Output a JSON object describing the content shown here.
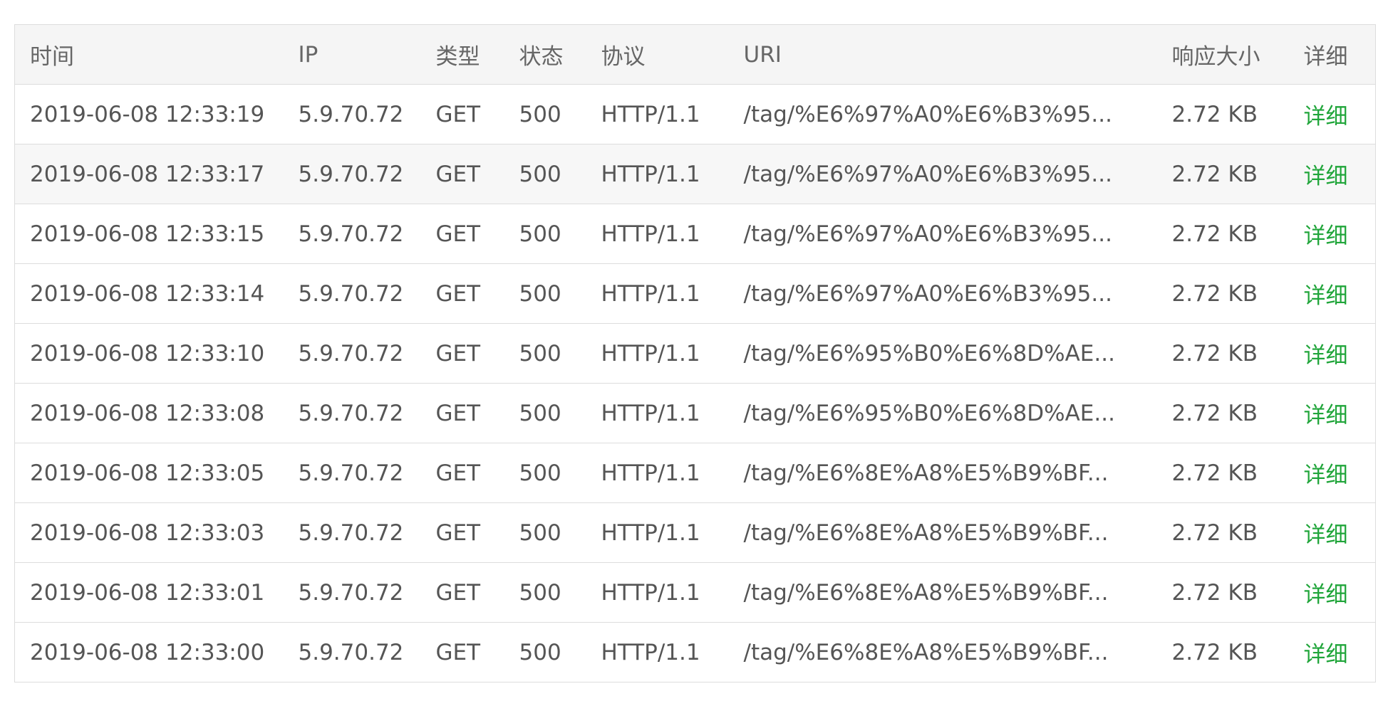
{
  "columns": {
    "time": "时间",
    "ip": "IP",
    "type": "类型",
    "status": "状态",
    "protocol": "协议",
    "uri": "URI",
    "size": "响应大小",
    "detail": "详细"
  },
  "rows": [
    {
      "time": "2019-06-08 12:33:19",
      "ip": "5.9.70.72",
      "type": "GET",
      "status": "500",
      "protocol": "HTTP/1.1",
      "uri": "/tag/%E6%97%A0%E6%B3%95...",
      "size": "2.72 KB",
      "detail": "详细"
    },
    {
      "time": "2019-06-08 12:33:17",
      "ip": "5.9.70.72",
      "type": "GET",
      "status": "500",
      "protocol": "HTTP/1.1",
      "uri": "/tag/%E6%97%A0%E6%B3%95...",
      "size": "2.72 KB",
      "detail": "详细"
    },
    {
      "time": "2019-06-08 12:33:15",
      "ip": "5.9.70.72",
      "type": "GET",
      "status": "500",
      "protocol": "HTTP/1.1",
      "uri": "/tag/%E6%97%A0%E6%B3%95...",
      "size": "2.72 KB",
      "detail": "详细"
    },
    {
      "time": "2019-06-08 12:33:14",
      "ip": "5.9.70.72",
      "type": "GET",
      "status": "500",
      "protocol": "HTTP/1.1",
      "uri": "/tag/%E6%97%A0%E6%B3%95...",
      "size": "2.72 KB",
      "detail": "详细"
    },
    {
      "time": "2019-06-08 12:33:10",
      "ip": "5.9.70.72",
      "type": "GET",
      "status": "500",
      "protocol": "HTTP/1.1",
      "uri": "/tag/%E6%95%B0%E6%8D%AE...",
      "size": "2.72 KB",
      "detail": "详细"
    },
    {
      "time": "2019-06-08 12:33:08",
      "ip": "5.9.70.72",
      "type": "GET",
      "status": "500",
      "protocol": "HTTP/1.1",
      "uri": "/tag/%E6%95%B0%E6%8D%AE...",
      "size": "2.72 KB",
      "detail": "详细"
    },
    {
      "time": "2019-06-08 12:33:05",
      "ip": "5.9.70.72",
      "type": "GET",
      "status": "500",
      "protocol": "HTTP/1.1",
      "uri": "/tag/%E6%8E%A8%E5%B9%BF...",
      "size": "2.72 KB",
      "detail": "详细"
    },
    {
      "time": "2019-06-08 12:33:03",
      "ip": "5.9.70.72",
      "type": "GET",
      "status": "500",
      "protocol": "HTTP/1.1",
      "uri": "/tag/%E6%8E%A8%E5%B9%BF...",
      "size": "2.72 KB",
      "detail": "详细"
    },
    {
      "time": "2019-06-08 12:33:01",
      "ip": "5.9.70.72",
      "type": "GET",
      "status": "500",
      "protocol": "HTTP/1.1",
      "uri": "/tag/%E6%8E%A8%E5%B9%BF...",
      "size": "2.72 KB",
      "detail": "详细"
    },
    {
      "time": "2019-06-08 12:33:00",
      "ip": "5.9.70.72",
      "type": "GET",
      "status": "500",
      "protocol": "HTTP/1.1",
      "uri": "/tag/%E6%8E%A8%E5%B9%BF...",
      "size": "2.72 KB",
      "detail": "详细"
    }
  ],
  "colors": {
    "header_bg": "#f5f5f5",
    "striped_row_bg": "#f7f7f7",
    "text": "#555555",
    "link": "#20a53a",
    "border": "#dddddd"
  }
}
